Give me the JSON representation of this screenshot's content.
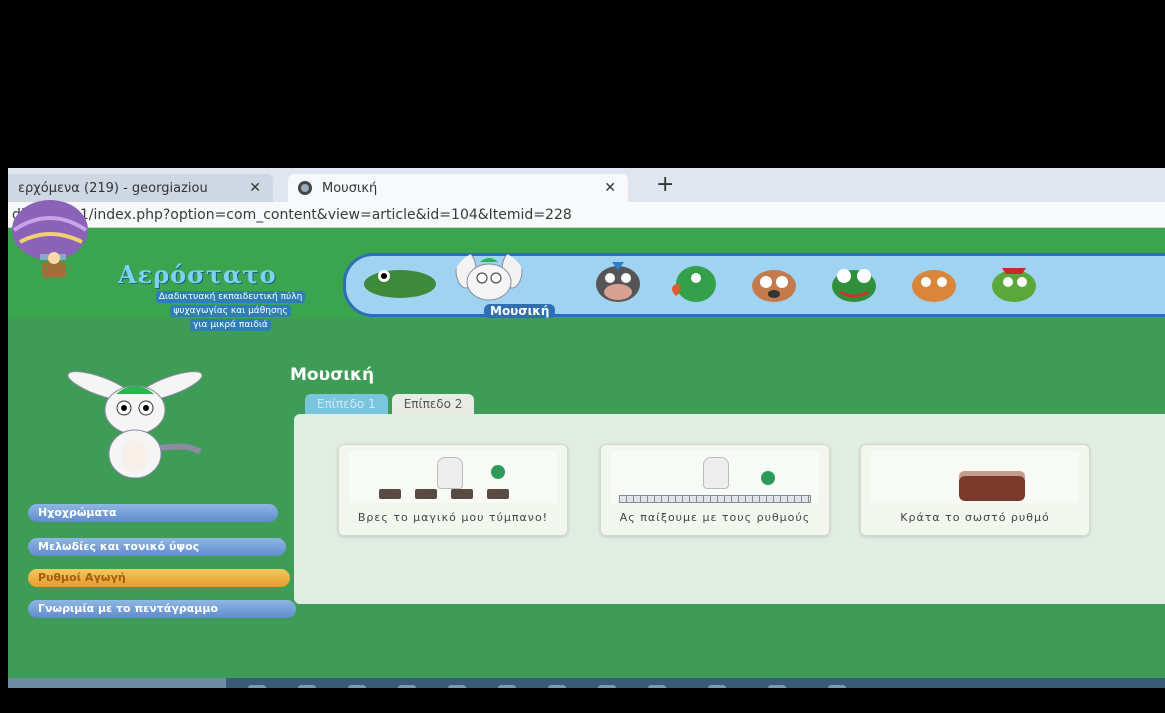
{
  "browser": {
    "tabs": [
      {
        "label": "ερχόμενα (219) - georgiaziou",
        "close": "✕",
        "active": false
      },
      {
        "label": "Μουσική",
        "close": "✕",
        "active": true
      }
    ],
    "new_tab": "+",
    "url": "dia.gr/ccs1/index.php?option=com_content&view=article&id=104&Itemid=228"
  },
  "site": {
    "logo_title": "Αερόστατο",
    "logo_subtitle_lines": [
      "Διαδικτυακή εκπαιδευτική πύλη",
      "ψυχαγωγίας και μάθησης",
      "για μικρά παιδιά"
    ],
    "character_strip_label": "Μουσική",
    "characters": [
      "crocodile",
      "bunny",
      "cow",
      "parrot",
      "dog",
      "frog",
      "cat",
      "turtle"
    ]
  },
  "page": {
    "title": "Μουσική",
    "level_tabs": [
      "Επίπεδο 1",
      "Επίπεδο 2"
    ],
    "cards": [
      {
        "title": "Βρες το μαγικό μου τύμπανο!"
      },
      {
        "title": "Ας παίξουμε με τους ρυθμούς"
      },
      {
        "title": "Κράτα το σωστό ρυθμό"
      }
    ]
  },
  "sidebar": {
    "buttons": [
      "Ηχοχρώματα",
      "Μελωδίες και τονικό ύψος",
      "Ρυθμοί Αγωγή",
      "Γνωριμία με το πεντάγραμμο"
    ]
  },
  "colors": {
    "page_bg": "#3f9c57",
    "accent_blue": "#2d6fb0",
    "panel": "#e1ece3"
  }
}
